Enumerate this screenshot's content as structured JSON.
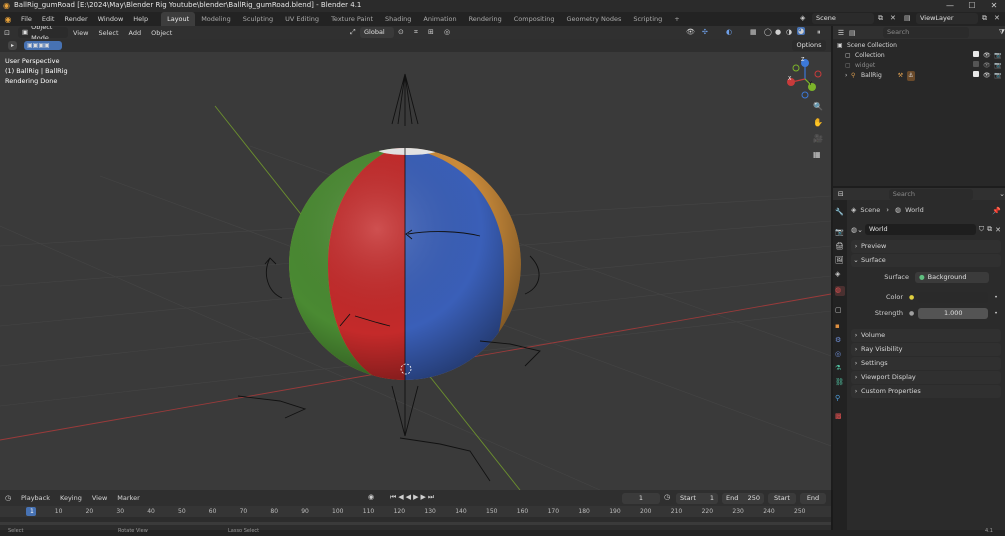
{
  "window": {
    "title": "BallRig_gumRoad [E:\\2024\\May\\Blender Rig Youtube\\blender\\BallRig_gumRoad.blend] - Blender 4.1",
    "min": "—",
    "max": "☐",
    "close": "✕"
  },
  "menus": [
    "File",
    "Edit",
    "Render",
    "Window",
    "Help"
  ],
  "workspaces": [
    "Layout",
    "Modeling",
    "Sculpting",
    "UV Editing",
    "Texture Paint",
    "Shading",
    "Animation",
    "Rendering",
    "Compositing",
    "Geometry Nodes",
    "Scripting"
  ],
  "add_workspace": "+",
  "scene": {
    "name": "Scene",
    "view_layer": "ViewLayer"
  },
  "viewport": {
    "mode": "Object Mode",
    "menus": [
      "View",
      "Select",
      "Add",
      "Object"
    ],
    "transform": "Global",
    "options": "Options",
    "info": [
      "User Perspective",
      "(1) BallRig | BallRig",
      "Rendering Done"
    ],
    "gizmo": {
      "x": "X",
      "y": "Y",
      "z": "Z"
    }
  },
  "outliner": {
    "search_placeholder": "Search",
    "items": [
      {
        "label": "Scene Collection"
      },
      {
        "label": "Collection"
      },
      {
        "label": "widget"
      },
      {
        "label": "BallRig"
      }
    ]
  },
  "properties": {
    "search_placeholder": "Search",
    "breadcrumb": [
      "Scene",
      "World"
    ],
    "world_name": "World",
    "panels": {
      "preview": "Preview",
      "surface": "Surface",
      "surface_label": "Surface",
      "surface_value": "Background",
      "color_label": "Color",
      "strength_label": "Strength",
      "strength_value": "1.000",
      "volume": "Volume",
      "ray_visibility": "Ray Visibility",
      "settings": "Settings",
      "viewport_display": "Viewport Display",
      "custom_properties": "Custom Properties"
    }
  },
  "timeline": {
    "menus": [
      "Playback",
      "Keying",
      "View",
      "Marker"
    ],
    "current_frame": "1",
    "start_label": "Start",
    "start_value": "1",
    "end_label": "End",
    "end_value": "250",
    "start_button": "Start",
    "end_button": "End",
    "ticks": [
      "1",
      "10",
      "20",
      "30",
      "40",
      "50",
      "60",
      "70",
      "80",
      "90",
      "100",
      "110",
      "120",
      "130",
      "140",
      "150",
      "160",
      "170",
      "180",
      "190",
      "200",
      "210",
      "220",
      "230",
      "240",
      "250"
    ]
  },
  "status": {
    "select": "Select",
    "rotate": "Rotate View",
    "lasso": "Lasso Select",
    "version": "4.1"
  },
  "colors": {
    "ball_red": "#c42a2a",
    "ball_blue": "#3a5fb8",
    "ball_green": "#4a8a32",
    "ball_orange": "#c98a3a",
    "accent": "#4772b3"
  }
}
